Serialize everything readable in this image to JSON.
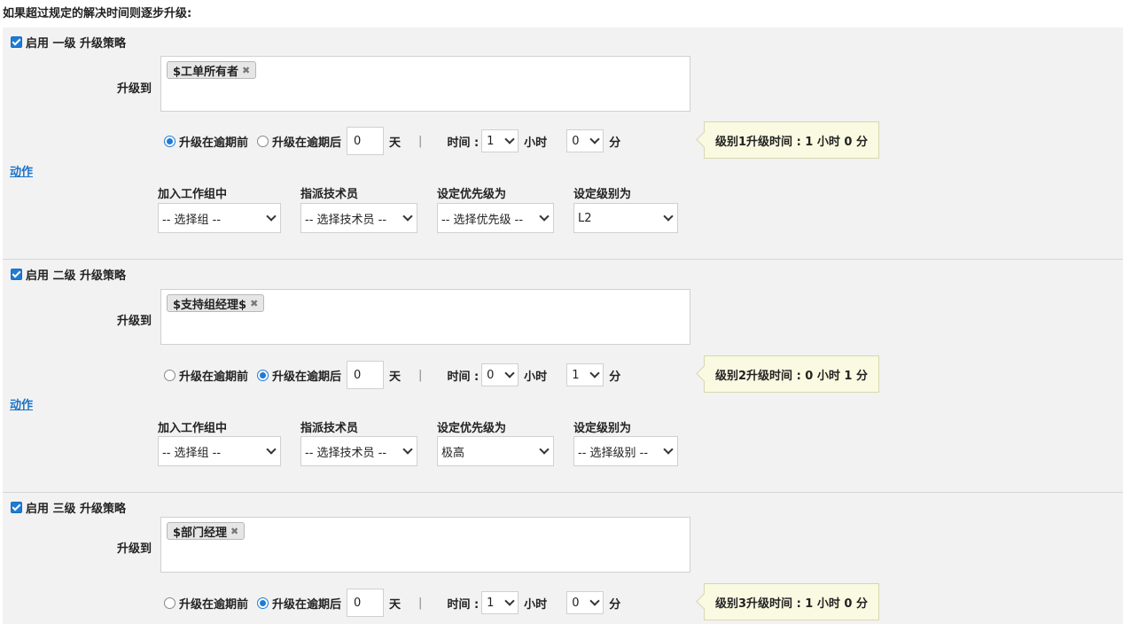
{
  "heading": "如果超过规定的解决时间则逐步升级:",
  "levels": [
    {
      "enable_label": "启用 一级 升级策略",
      "to_label": "升级到",
      "chip": "$工单所有者",
      "before_label": "升级在逾期前",
      "after_label": "升级在逾期后",
      "selected_mode": "before",
      "days_value": "0",
      "days_unit": "天",
      "separator": "|",
      "time_label": "时间 :",
      "hour_value": "1",
      "hour_unit": "小时",
      "minute_value": "0",
      "minute_unit": "分",
      "tip": "级别1升级时间 : 1 小时 0 分",
      "action_label": "动作",
      "group_label": "加入工作组中",
      "group_value": "-- 选择组 --",
      "tech_label": "指派技术员",
      "tech_value": "-- 选择技术员 --",
      "priority_label": "设定优先级为",
      "priority_value": "-- 选择优先级 --",
      "level_label": "设定级别为",
      "level_value": "L2"
    },
    {
      "enable_label": "启用 二级 升级策略",
      "to_label": "升级到",
      "chip": "$支持组经理$",
      "before_label": "升级在逾期前",
      "after_label": "升级在逾期后",
      "selected_mode": "after",
      "days_value": "0",
      "days_unit": "天",
      "separator": "|",
      "time_label": "时间 :",
      "hour_value": "0",
      "hour_unit": "小时",
      "minute_value": "1",
      "minute_unit": "分",
      "tip": "级别2升级时间 : 0 小时 1 分",
      "action_label": "动作",
      "group_label": "加入工作组中",
      "group_value": "-- 选择组 --",
      "tech_label": "指派技术员",
      "tech_value": "-- 选择技术员 --",
      "priority_label": "设定优先级为",
      "priority_value": "极高",
      "level_label": "设定级别为",
      "level_value": "-- 选择级别 --"
    },
    {
      "enable_label": "启用 三级 升级策略",
      "to_label": "升级到",
      "chip": "$部门经理",
      "before_label": "升级在逾期前",
      "after_label": "升级在逾期后",
      "selected_mode": "after",
      "days_value": "0",
      "days_unit": "天",
      "separator": "|",
      "time_label": "时间 :",
      "hour_value": "1",
      "hour_unit": "小时",
      "minute_value": "0",
      "minute_unit": "分",
      "tip": "级别3升级时间 : 1 小时 0 分"
    }
  ]
}
